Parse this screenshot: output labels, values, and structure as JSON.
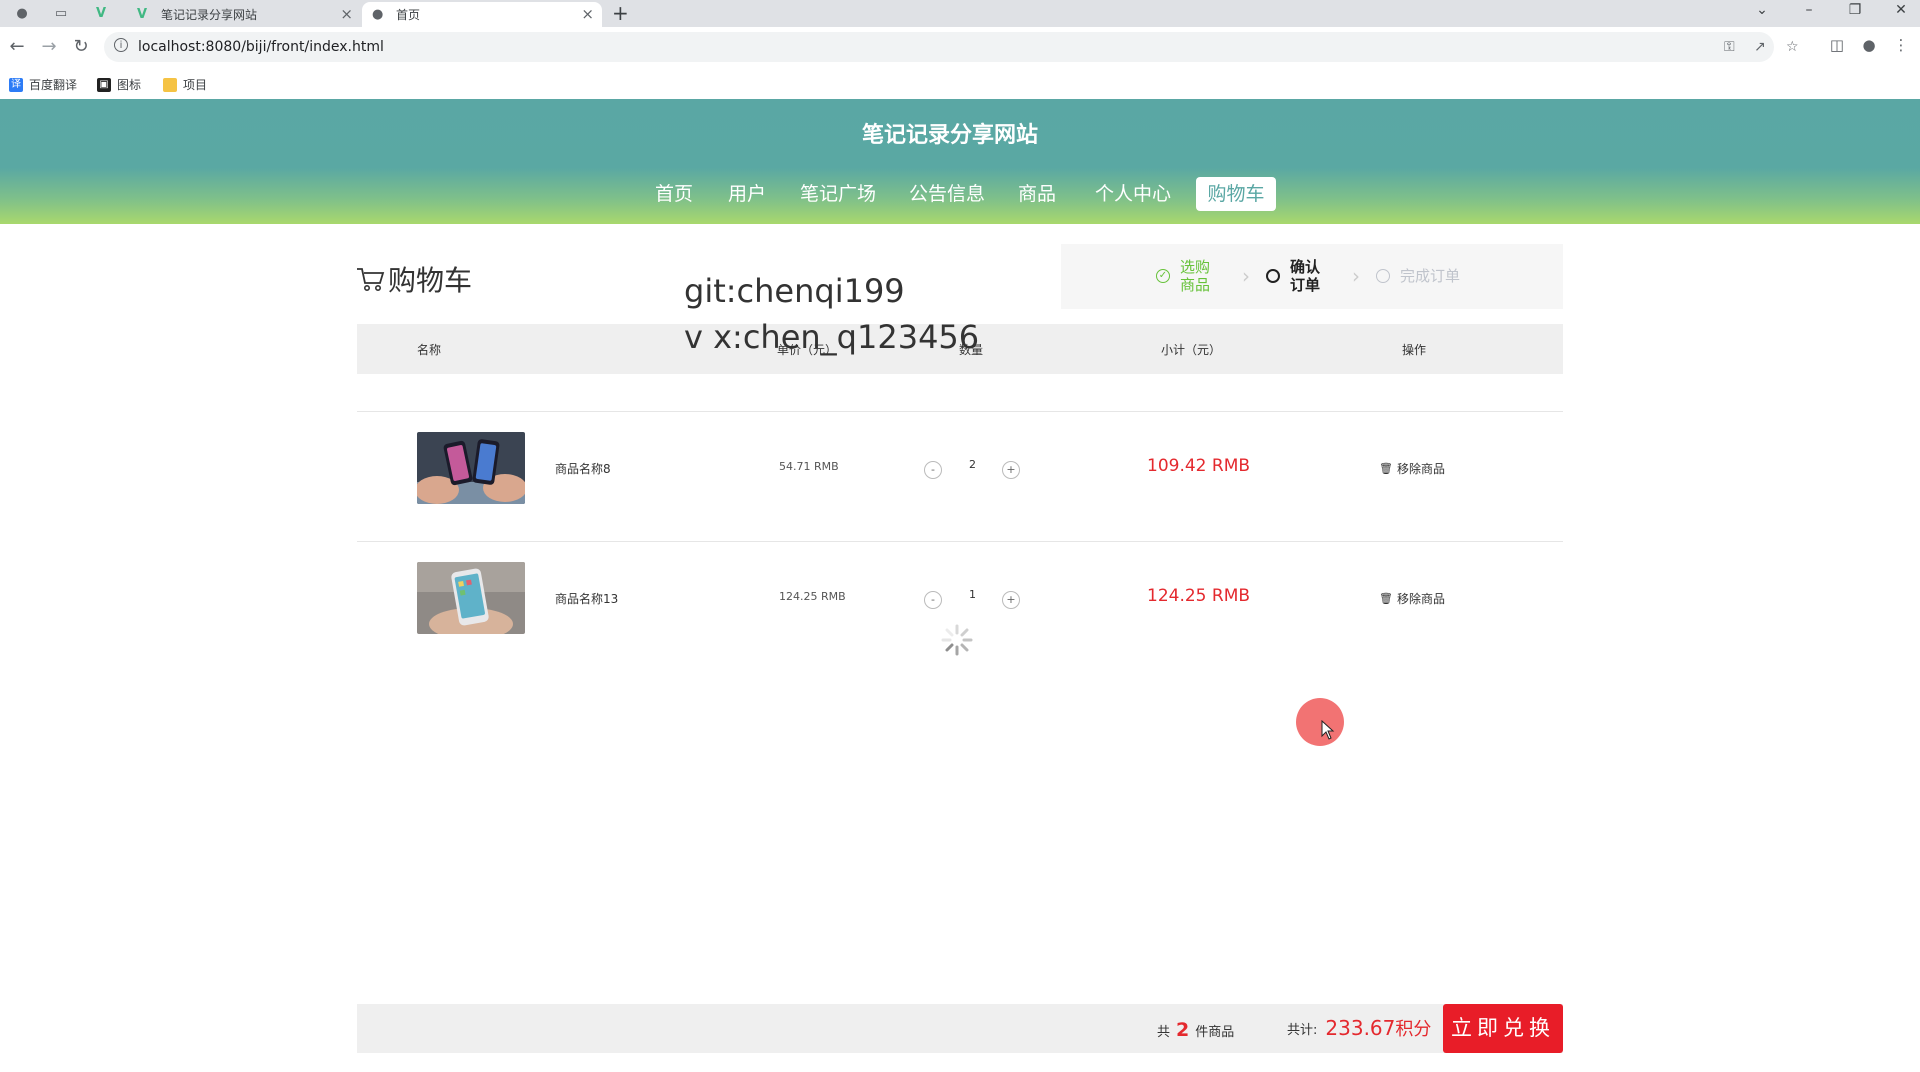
{
  "browser": {
    "tabs": [
      {
        "title": "笔记记录分享网站",
        "icon": "vue-logo-icon",
        "active": false
      },
      {
        "title": "首页",
        "icon": "globe-icon",
        "active": true
      }
    ],
    "url": "localhost:8080/biji/front/index.html",
    "bookmarks": [
      "百度翻译",
      "图标",
      "项目"
    ]
  },
  "site": {
    "title": "笔记记录分享网站",
    "menu": [
      "首页",
      "用户",
      "笔记广场",
      "公告信息",
      "商品",
      "个人中心",
      "购物车"
    ],
    "active_menu": "购物车"
  },
  "cart": {
    "title": "购物车",
    "watermark_lines": [
      "git:chenqi199",
      "v x:chen_q123456"
    ],
    "steps": [
      {
        "label_line1": "选购",
        "label_line2": "商品",
        "state": "done"
      },
      {
        "label_line1": "确认",
        "label_line2": "订单",
        "state": "current"
      },
      {
        "label_line1": "完成订单",
        "label_line2": "",
        "state": "pending"
      }
    ],
    "columns": [
      "名称",
      "单价（元）",
      "数量",
      "小计（元）",
      "操作"
    ],
    "items": [
      {
        "name": "商品名称8",
        "price": "54.71 RMB",
        "qty": "2",
        "subtotal": "109.42 RMB",
        "remove": "移除商品",
        "minus": "-",
        "plus": "+"
      },
      {
        "name": "商品名称13",
        "price": "124.25 RMB",
        "qty": "1",
        "subtotal": "124.25 RMB",
        "remove": "移除商品",
        "minus": "-",
        "plus": "+"
      }
    ],
    "footer": {
      "count_prefix": "共",
      "count": "2",
      "count_suffix": "件商品",
      "total_label": "共计:",
      "total_value": "233.67",
      "total_unit": "积分",
      "submit_label": "立即兑换"
    }
  },
  "colors": {
    "theme": "#5aa7a4",
    "price_red": "#e4292e",
    "button_red": "#e81d28",
    "step_done": "#67c23a"
  }
}
